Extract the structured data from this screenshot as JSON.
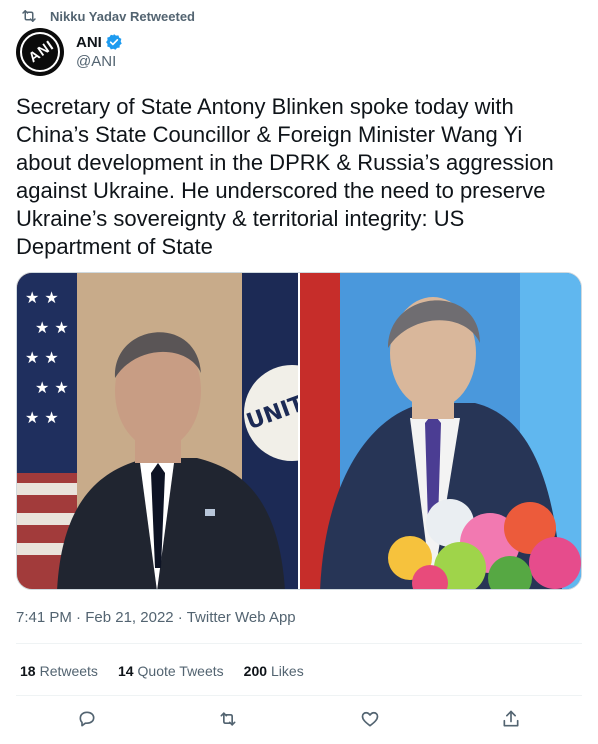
{
  "retweet": {
    "text": "Nikku Yadav Retweeted",
    "icon": "retweet-icon"
  },
  "author": {
    "name": "ANI",
    "handle": "@ANI",
    "avatar_logo_text": "ANI",
    "verified_icon": "verified-badge-icon"
  },
  "tweet": {
    "text": "Secretary of State Antony Blinken spoke today with China’s State Councillor & Foreign Minister Wang Yi about development in the DPRK & Russia’s aggression against Ukraine. He underscored the need to preserve Ukraine’s sovereignty & territorial integrity: US Department of State"
  },
  "media": {
    "seal_text": "UNITE"
  },
  "meta": {
    "time": "7:41 PM",
    "separator1": " · ",
    "date": "Feb 21, 2022",
    "separator2": " · ",
    "source": "Twitter Web App"
  },
  "stats": [
    {
      "count": "18",
      "label": "Retweets"
    },
    {
      "count": "14",
      "label": "Quote Tweets"
    },
    {
      "count": "200",
      "label": "Likes"
    }
  ],
  "actions": [
    {
      "icon": "reply-icon"
    },
    {
      "icon": "retweet-icon"
    },
    {
      "icon": "like-icon"
    },
    {
      "icon": "share-icon"
    }
  ],
  "colors": {
    "text": "#0f1419",
    "secondary": "#536471",
    "verified": "#1d9bf0",
    "border": "#eff3f4"
  }
}
